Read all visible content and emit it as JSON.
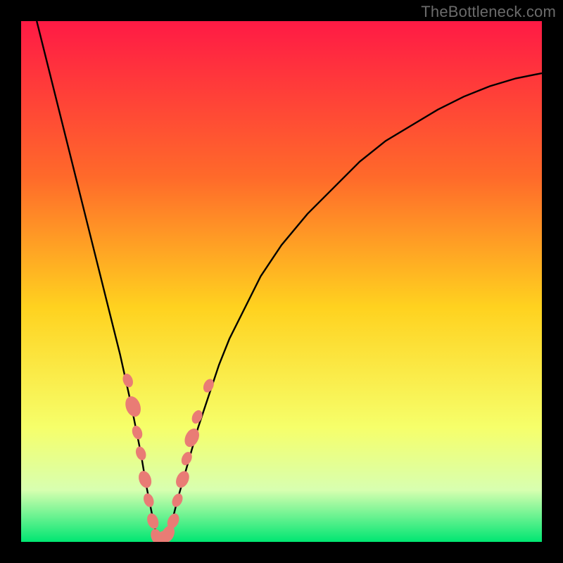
{
  "watermark": "TheBottleneck.com",
  "colors": {
    "frame": "#000000",
    "grad_top": "#ff1a45",
    "grad_mid1": "#ff6a2a",
    "grad_mid2": "#ffd21f",
    "grad_low1": "#f6ff6a",
    "grad_low2": "#d8ffb0",
    "grad_bottom": "#00e672",
    "curve": "#000000",
    "marker_fill": "#e97c75",
    "marker_stroke": "#cf5a55"
  },
  "chart_data": {
    "type": "line",
    "title": "",
    "xlabel": "",
    "ylabel": "",
    "xlim": [
      0,
      100
    ],
    "ylim": [
      0,
      100
    ],
    "notes": "V-shaped bottleneck curve; vertex near x≈26 y≈0. No axis ticks shown. Background is a vertical gradient red→orange→yellow→green.",
    "series": [
      {
        "name": "bottleneck-curve",
        "x": [
          3,
          5,
          7,
          9,
          11,
          13,
          15,
          17,
          19,
          21,
          23,
          24,
          25,
          26,
          27,
          28,
          29,
          30,
          32,
          34,
          36,
          38,
          40,
          43,
          46,
          50,
          55,
          60,
          65,
          70,
          75,
          80,
          85,
          90,
          95,
          100
        ],
        "y": [
          100,
          92,
          84,
          76,
          68,
          60,
          52,
          44,
          36,
          27,
          17,
          11,
          6,
          1,
          0,
          1,
          4,
          8,
          15,
          22,
          28,
          34,
          39,
          45,
          51,
          57,
          63,
          68,
          73,
          77,
          80,
          83,
          85.5,
          87.5,
          89,
          90
        ]
      }
    ],
    "markers": {
      "name": "highlighted-points",
      "shape": "pill",
      "points": [
        {
          "x": 20.5,
          "y": 31,
          "r": 8
        },
        {
          "x": 21.5,
          "y": 26,
          "r": 12
        },
        {
          "x": 22.3,
          "y": 21,
          "r": 8
        },
        {
          "x": 23.0,
          "y": 17,
          "r": 8
        },
        {
          "x": 23.8,
          "y": 12,
          "r": 10
        },
        {
          "x": 24.5,
          "y": 8,
          "r": 8
        },
        {
          "x": 25.3,
          "y": 4,
          "r": 9
        },
        {
          "x": 26.0,
          "y": 1,
          "r": 9
        },
        {
          "x": 27.0,
          "y": 0.5,
          "r": 10
        },
        {
          "x": 28.2,
          "y": 1.5,
          "r": 10
        },
        {
          "x": 29.2,
          "y": 4,
          "r": 9
        },
        {
          "x": 30.0,
          "y": 8,
          "r": 8
        },
        {
          "x": 31.0,
          "y": 12,
          "r": 10
        },
        {
          "x": 31.8,
          "y": 16,
          "r": 8
        },
        {
          "x": 32.8,
          "y": 20,
          "r": 11
        },
        {
          "x": 33.8,
          "y": 24,
          "r": 8
        },
        {
          "x": 36.0,
          "y": 30,
          "r": 8
        }
      ]
    }
  }
}
